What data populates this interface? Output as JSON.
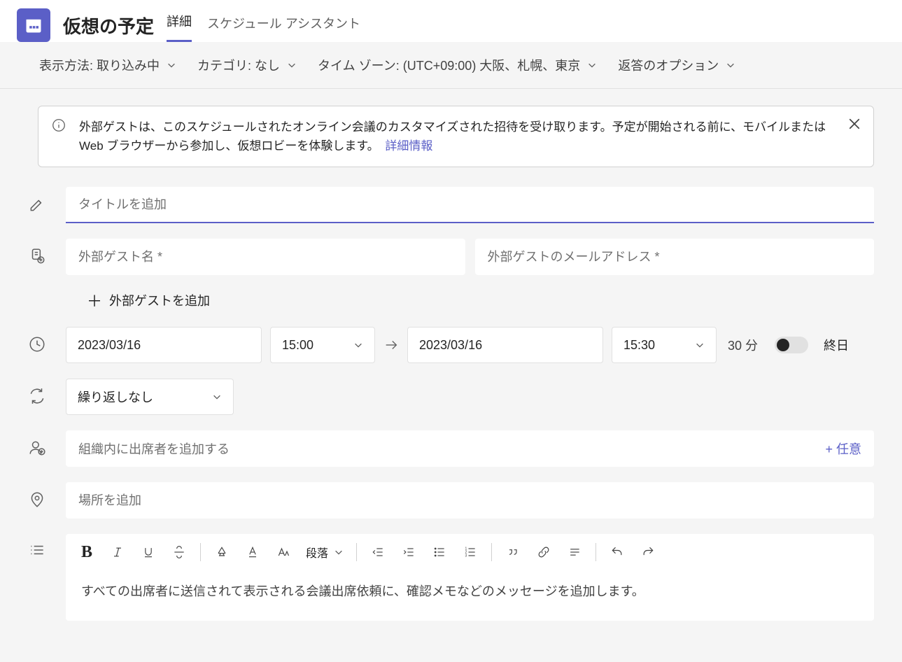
{
  "header": {
    "title": "仮想の予定",
    "tabs": {
      "detail": "詳細",
      "assistant": "スケジュール アシスタント"
    }
  },
  "options": {
    "showAs": "表示方法: 取り込み中",
    "category": "カテゴリ: なし",
    "timezone": "タイム ゾーン: (UTC+09:00) 大阪、札幌、東京",
    "responseOptions": "返答のオプション"
  },
  "banner": {
    "text": "外部ゲストは、このスケジュールされたオンライン会議のカスタマイズされた招待を受け取ります。予定が開始される前に、モバイルまたは Web ブラウザーから参加し、仮想ロビーを体験します。",
    "moreInfo": "詳細情報"
  },
  "form": {
    "titlePlaceholder": "タイトルを追加",
    "guestNamePlaceholder": "外部ゲスト名 *",
    "guestEmailPlaceholder": "外部ゲストのメールアドレス *",
    "addGuest": "外部ゲストを追加",
    "startDate": "2023/03/16",
    "startTime": "15:00",
    "endDate": "2023/03/16",
    "endTime": "15:30",
    "duration": "30 分",
    "allDay": "終日",
    "repeat": "繰り返しなし",
    "addAttendeePlaceholder": "組織内に出席者を追加する",
    "optional": "+ 任意",
    "locationPlaceholder": "場所を追加",
    "paragraph": "段落",
    "bodyPlaceholder": "すべての出席者に送信されて表示される会議出席依頼に、確認メモなどのメッセージを追加します。"
  }
}
